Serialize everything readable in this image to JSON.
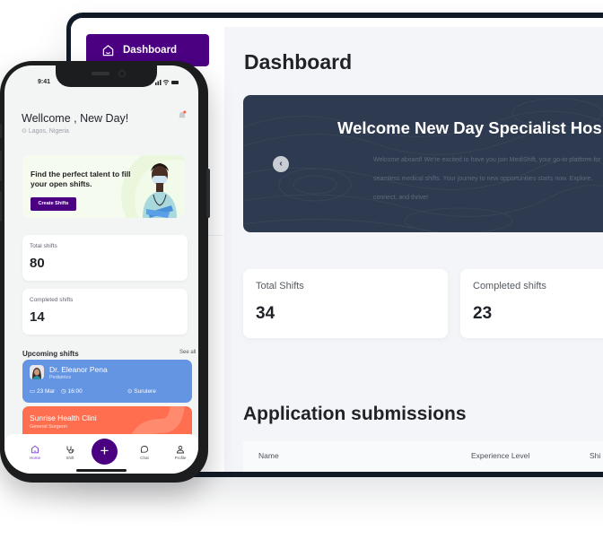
{
  "desktop": {
    "sidebar": {
      "active_item": {
        "label": "Dashboard",
        "icon": "home-icon"
      }
    },
    "page_title": "Dashboard",
    "hero": {
      "title": "Welcome New Day Specialist Hos",
      "body": "Welcome aboard! We're excited to have you join MediShift, your go-to platform for seamless medical shifts. Your journey to new opportunities starts now. Explore, connect, and thrive!",
      "prev_button_icon": "chevron-left-icon",
      "prev_button_glyph": "‹"
    },
    "stats": [
      {
        "label": "Total Shifts",
        "value": "34"
      },
      {
        "label": "Completed shifts",
        "value": "23"
      }
    ],
    "section_title": "Application submissions",
    "table": {
      "columns": [
        "Name",
        "Experience Level",
        "Shi"
      ]
    }
  },
  "mobile": {
    "status_bar": {
      "time": "9:41",
      "icons": "▂▄▆ ≋ ▬"
    },
    "greeting": "Wellcome , New Day!",
    "location": "Lagos, Nigeria",
    "promo": {
      "text": "Find the perfect talent to fill your open shifts.",
      "button": "Create Shifts"
    },
    "stats": [
      {
        "label": "Total shifts",
        "value": "80"
      },
      {
        "label": "Completed shifts",
        "value": "14"
      }
    ],
    "upcoming_title": "Upcoming shifts",
    "see_all": "See all",
    "shifts": [
      {
        "name": "Dr. Eleanor Pena",
        "specialty": "Pediatrics",
        "date": "23 Mar",
        "time": "16:00",
        "location": "Surulere"
      },
      {
        "name": "Sunrise Health Clini",
        "specialty": "General Surgeon"
      }
    ],
    "tabbar": {
      "items": [
        {
          "label": "Home",
          "icon": "home-icon",
          "active": true
        },
        {
          "label": "Shift",
          "icon": "stethoscope-icon",
          "active": false
        },
        {
          "label": "Chat",
          "icon": "chat-icon",
          "active": false
        },
        {
          "label": "Profile",
          "icon": "user-icon",
          "active": false
        }
      ],
      "fab_glyph": "+"
    }
  },
  "colors": {
    "brand_purple": "#4b0082",
    "hero_bg": "#2e3a4f",
    "shift_blue": "#6495e3",
    "shift_orange": "#ff6f4f",
    "notification_dot": "#ff5a4a"
  }
}
